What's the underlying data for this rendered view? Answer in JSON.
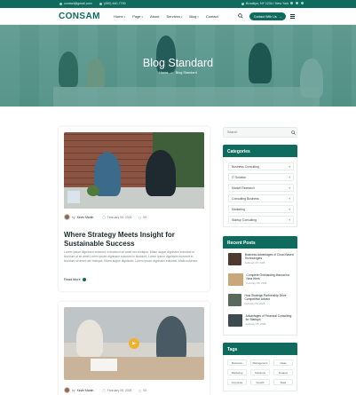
{
  "topbar": {
    "email": "contact@gmail.com",
    "phone": "(000) 440-7700",
    "address": "Brooklyn, NY 1234 / New York"
  },
  "header": {
    "logo": "CONSAM",
    "nav": [
      "Home",
      "Page",
      "About",
      "Services",
      "Blog",
      "Contact"
    ],
    "cta": "Contact With Us"
  },
  "hero": {
    "title": "Blog Standard",
    "crumb_home": "Home",
    "crumb_sep": ">",
    "crumb_current": "Blog Standard"
  },
  "posts": [
    {
      "author_prefix": "by",
      "author": "Kevin Martin",
      "date": "February 05, 2025",
      "comments": "05",
      "title": "Where Strategy Meets Insight for Sustainable Success",
      "excerpt": "Lorem ipsum dignissim euismod in tincidunt sit amet nec tristique. Etiam augue dignissim euismod in tincidunt ut sit amet Lorem ipsum dignissim euismod in tincidunt. Lorem ipsum dignissim euismod in tincidunt sit amet nec tristique. Etiam augue dignissim. Lorem ipsum dignissim euismod. Mata nubentur.",
      "read_more": "Read More"
    },
    {
      "author_prefix": "by",
      "author": "Kevin Martin",
      "date": "February 05, 2025",
      "comments": "05"
    }
  ],
  "sidebar": {
    "search_placeholder": "Search",
    "categories_title": "Categories",
    "categories": [
      "Business Consulting",
      "IT Solution",
      "Market Research",
      "Consulting Business",
      "Marketing",
      "Startup Consulting"
    ],
    "recent_title": "Recent Posts",
    "recent": [
      {
        "title": "Business Advantages of Cloud Based Technologies",
        "date": "February 05, 2025"
      },
      {
        "title": "Complete Onboarding Manual for New Hires",
        "date": "February 05, 2025"
      },
      {
        "title": "How Strategic Partnership Drive Competitive Advant",
        "date": "February 05, 2025"
      },
      {
        "title": "Advantages of Financial Consulting for Startups",
        "date": "February 05, 2025"
      }
    ],
    "tags_title": "Tags",
    "tags": [
      "Business",
      "Management",
      "Ideas",
      "Marketing",
      "Solutions",
      "Finance",
      "Corporate",
      "Growth",
      "Data"
    ]
  },
  "colors": {
    "brand": "#0f6b5e",
    "text": "#1c2b2b"
  }
}
